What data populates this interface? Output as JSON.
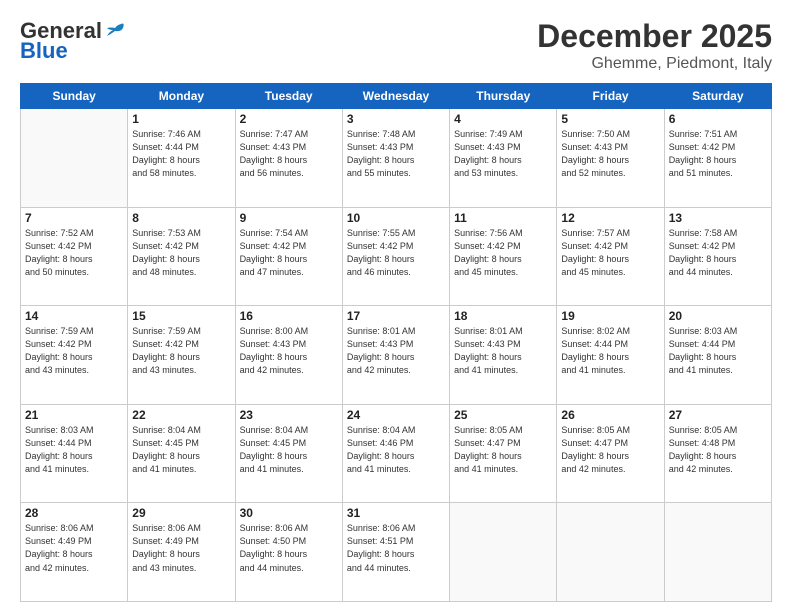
{
  "header": {
    "logo_general": "General",
    "logo_blue": "Blue",
    "month": "December 2025",
    "location": "Ghemme, Piedmont, Italy"
  },
  "weekdays": [
    "Sunday",
    "Monday",
    "Tuesday",
    "Wednesday",
    "Thursday",
    "Friday",
    "Saturday"
  ],
  "weeks": [
    [
      {
        "day": "",
        "info": ""
      },
      {
        "day": "1",
        "info": "Sunrise: 7:46 AM\nSunset: 4:44 PM\nDaylight: 8 hours\nand 58 minutes."
      },
      {
        "day": "2",
        "info": "Sunrise: 7:47 AM\nSunset: 4:43 PM\nDaylight: 8 hours\nand 56 minutes."
      },
      {
        "day": "3",
        "info": "Sunrise: 7:48 AM\nSunset: 4:43 PM\nDaylight: 8 hours\nand 55 minutes."
      },
      {
        "day": "4",
        "info": "Sunrise: 7:49 AM\nSunset: 4:43 PM\nDaylight: 8 hours\nand 53 minutes."
      },
      {
        "day": "5",
        "info": "Sunrise: 7:50 AM\nSunset: 4:43 PM\nDaylight: 8 hours\nand 52 minutes."
      },
      {
        "day": "6",
        "info": "Sunrise: 7:51 AM\nSunset: 4:42 PM\nDaylight: 8 hours\nand 51 minutes."
      }
    ],
    [
      {
        "day": "7",
        "info": "Sunrise: 7:52 AM\nSunset: 4:42 PM\nDaylight: 8 hours\nand 50 minutes."
      },
      {
        "day": "8",
        "info": "Sunrise: 7:53 AM\nSunset: 4:42 PM\nDaylight: 8 hours\nand 48 minutes."
      },
      {
        "day": "9",
        "info": "Sunrise: 7:54 AM\nSunset: 4:42 PM\nDaylight: 8 hours\nand 47 minutes."
      },
      {
        "day": "10",
        "info": "Sunrise: 7:55 AM\nSunset: 4:42 PM\nDaylight: 8 hours\nand 46 minutes."
      },
      {
        "day": "11",
        "info": "Sunrise: 7:56 AM\nSunset: 4:42 PM\nDaylight: 8 hours\nand 45 minutes."
      },
      {
        "day": "12",
        "info": "Sunrise: 7:57 AM\nSunset: 4:42 PM\nDaylight: 8 hours\nand 45 minutes."
      },
      {
        "day": "13",
        "info": "Sunrise: 7:58 AM\nSunset: 4:42 PM\nDaylight: 8 hours\nand 44 minutes."
      }
    ],
    [
      {
        "day": "14",
        "info": "Sunrise: 7:59 AM\nSunset: 4:42 PM\nDaylight: 8 hours\nand 43 minutes."
      },
      {
        "day": "15",
        "info": "Sunrise: 7:59 AM\nSunset: 4:42 PM\nDaylight: 8 hours\nand 43 minutes."
      },
      {
        "day": "16",
        "info": "Sunrise: 8:00 AM\nSunset: 4:43 PM\nDaylight: 8 hours\nand 42 minutes."
      },
      {
        "day": "17",
        "info": "Sunrise: 8:01 AM\nSunset: 4:43 PM\nDaylight: 8 hours\nand 42 minutes."
      },
      {
        "day": "18",
        "info": "Sunrise: 8:01 AM\nSunset: 4:43 PM\nDaylight: 8 hours\nand 41 minutes."
      },
      {
        "day": "19",
        "info": "Sunrise: 8:02 AM\nSunset: 4:44 PM\nDaylight: 8 hours\nand 41 minutes."
      },
      {
        "day": "20",
        "info": "Sunrise: 8:03 AM\nSunset: 4:44 PM\nDaylight: 8 hours\nand 41 minutes."
      }
    ],
    [
      {
        "day": "21",
        "info": "Sunrise: 8:03 AM\nSunset: 4:44 PM\nDaylight: 8 hours\nand 41 minutes."
      },
      {
        "day": "22",
        "info": "Sunrise: 8:04 AM\nSunset: 4:45 PM\nDaylight: 8 hours\nand 41 minutes."
      },
      {
        "day": "23",
        "info": "Sunrise: 8:04 AM\nSunset: 4:45 PM\nDaylight: 8 hours\nand 41 minutes."
      },
      {
        "day": "24",
        "info": "Sunrise: 8:04 AM\nSunset: 4:46 PM\nDaylight: 8 hours\nand 41 minutes."
      },
      {
        "day": "25",
        "info": "Sunrise: 8:05 AM\nSunset: 4:47 PM\nDaylight: 8 hours\nand 41 minutes."
      },
      {
        "day": "26",
        "info": "Sunrise: 8:05 AM\nSunset: 4:47 PM\nDaylight: 8 hours\nand 42 minutes."
      },
      {
        "day": "27",
        "info": "Sunrise: 8:05 AM\nSunset: 4:48 PM\nDaylight: 8 hours\nand 42 minutes."
      }
    ],
    [
      {
        "day": "28",
        "info": "Sunrise: 8:06 AM\nSunset: 4:49 PM\nDaylight: 8 hours\nand 42 minutes."
      },
      {
        "day": "29",
        "info": "Sunrise: 8:06 AM\nSunset: 4:49 PM\nDaylight: 8 hours\nand 43 minutes."
      },
      {
        "day": "30",
        "info": "Sunrise: 8:06 AM\nSunset: 4:50 PM\nDaylight: 8 hours\nand 44 minutes."
      },
      {
        "day": "31",
        "info": "Sunrise: 8:06 AM\nSunset: 4:51 PM\nDaylight: 8 hours\nand 44 minutes."
      },
      {
        "day": "",
        "info": ""
      },
      {
        "day": "",
        "info": ""
      },
      {
        "day": "",
        "info": ""
      }
    ]
  ]
}
